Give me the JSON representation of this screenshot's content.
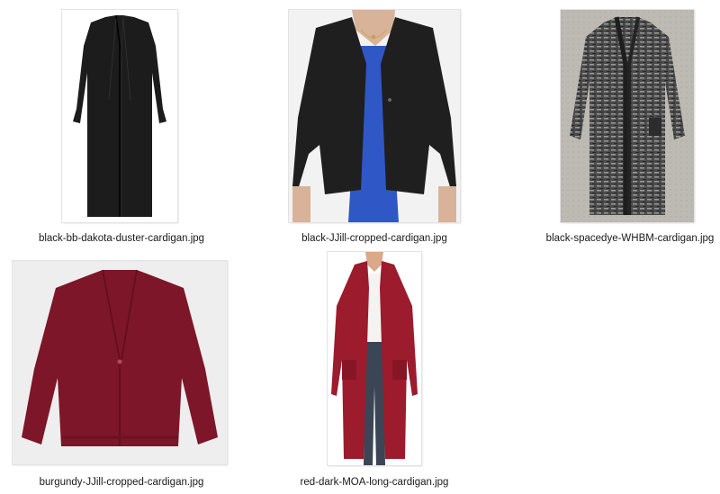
{
  "files": [
    {
      "name": "black-bb-dakota-duster-cardigan.jpg",
      "icon": "image-thumbnail-black-long-duster-cardigan"
    },
    {
      "name": "black-JJill-cropped-cardigan.jpg",
      "icon": "image-thumbnail-black-cropped-cardigan-on-model"
    },
    {
      "name": "black-spacedye-WHBM-cardigan.jpg",
      "icon": "image-thumbnail-gray-spacedye-long-cardigan"
    },
    {
      "name": "burgundy-JJill-cropped-cardigan.jpg",
      "icon": "image-thumbnail-burgundy-cropped-cardigan"
    },
    {
      "name": "red-dark-MOA-long-cardigan.jpg",
      "icon": "image-thumbnail-dark-red-long-cardigan-on-model"
    }
  ],
  "colors": {
    "black": "#1c1c1c",
    "charcoal": "#3a3a3a",
    "gray": "#8a8a8a",
    "burgundy": "#7d1628",
    "red": "#9c1b2c",
    "blue": "#2f57c6"
  }
}
